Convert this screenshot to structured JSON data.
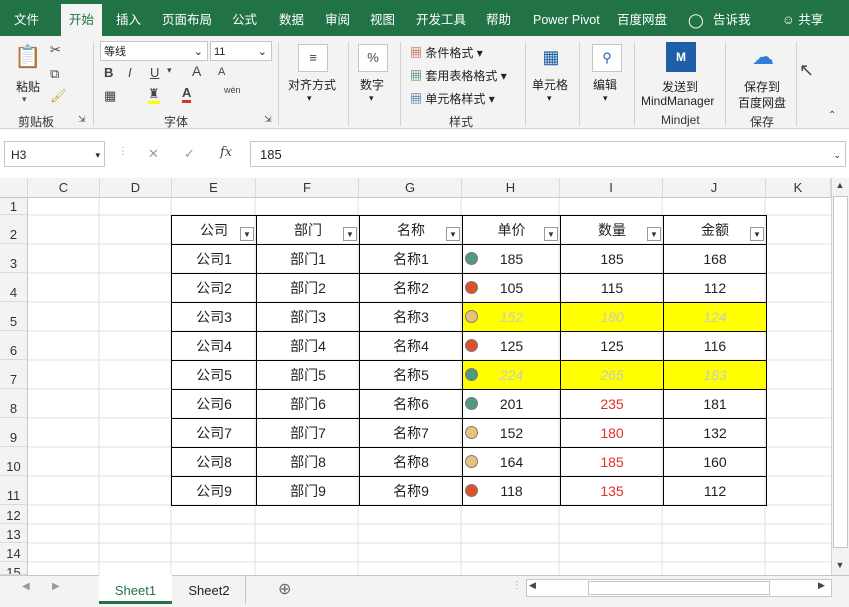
{
  "ribbon_tabs": [
    "文件",
    "开始",
    "插入",
    "页面布局",
    "公式",
    "数据",
    "审阅",
    "视图",
    "开发工具",
    "帮助",
    "Power Pivot",
    "百度网盘",
    "告诉我",
    "共享"
  ],
  "clipboard": {
    "paste": "粘贴",
    "group": "剪贴板"
  },
  "font": {
    "name": "等线",
    "size": "11",
    "group": "字体",
    "bold": "B",
    "italic": "I",
    "underline": "U",
    "grow": "A",
    "shrink": "A",
    "wen": "wén"
  },
  "align": {
    "label": "对齐方式"
  },
  "number": {
    "label": "数字",
    "icon": "%"
  },
  "styles": {
    "cond": "条件格式",
    "table": "套用表格格式",
    "cell": "单元格样式",
    "group": "样式"
  },
  "cells": {
    "label": "单元格"
  },
  "edit": {
    "label": "编辑"
  },
  "mindjet": {
    "line1": "发送到",
    "line2": "MindManager",
    "group": "Mindjet"
  },
  "save": {
    "line1": "保存到",
    "line2": "百度网盘",
    "group": "保存"
  },
  "formula_bar": {
    "name_box": "H3",
    "fx": "fx",
    "value": "185"
  },
  "columns": [
    "C",
    "D",
    "E",
    "F",
    "G",
    "H",
    "I",
    "J",
    "K"
  ],
  "rows": [
    "1",
    "2",
    "3",
    "4",
    "5",
    "6",
    "7",
    "8",
    "9",
    "10",
    "11",
    "12",
    "13",
    "14",
    "15"
  ],
  "table": {
    "headers": [
      "公司",
      "部门",
      "名称",
      "单价",
      "数量",
      "金额"
    ],
    "rows": [
      {
        "company": "公司1",
        "dept": "部门1",
        "name": "名称1",
        "dot": "#4f9a7f",
        "price": "185",
        "qty": "185",
        "amount": "168"
      },
      {
        "company": "公司2",
        "dept": "部门2",
        "name": "名称2",
        "dot": "#d9522a",
        "price": "105",
        "qty": "115",
        "amount": "112"
      },
      {
        "company": "公司3",
        "dept": "部门3",
        "name": "名称3",
        "dot": "#e8c27a",
        "price": "152",
        "qty": "180",
        "amount": "124"
      },
      {
        "company": "公司4",
        "dept": "部门4",
        "name": "名称4",
        "dot": "#d9522a",
        "price": "125",
        "qty": "125",
        "amount": "116"
      },
      {
        "company": "公司5",
        "dept": "部门5",
        "name": "名称5",
        "dot": "#4f9a7f",
        "price": "224",
        "qty": "265",
        "amount": "183"
      },
      {
        "company": "公司6",
        "dept": "部门6",
        "name": "名称6",
        "dot": "#4f9a7f",
        "price": "201",
        "qty": "235",
        "amount": "181"
      },
      {
        "company": "公司7",
        "dept": "部门7",
        "name": "名称7",
        "dot": "#e8c27a",
        "price": "152",
        "qty": "180",
        "amount": "132"
      },
      {
        "company": "公司8",
        "dept": "部门8",
        "name": "名称8",
        "dot": "#e8c27a",
        "price": "164",
        "qty": "185",
        "amount": "160"
      },
      {
        "company": "公司9",
        "dept": "部门9",
        "name": "名称9",
        "dot": "#d9522a",
        "price": "118",
        "qty": "135",
        "amount": "112"
      }
    ]
  },
  "sheets": [
    "Sheet1",
    "Sheet2"
  ],
  "colors": {
    "accent": "#217346",
    "highlight": "#ffff00",
    "red_text": "#e0302a"
  }
}
